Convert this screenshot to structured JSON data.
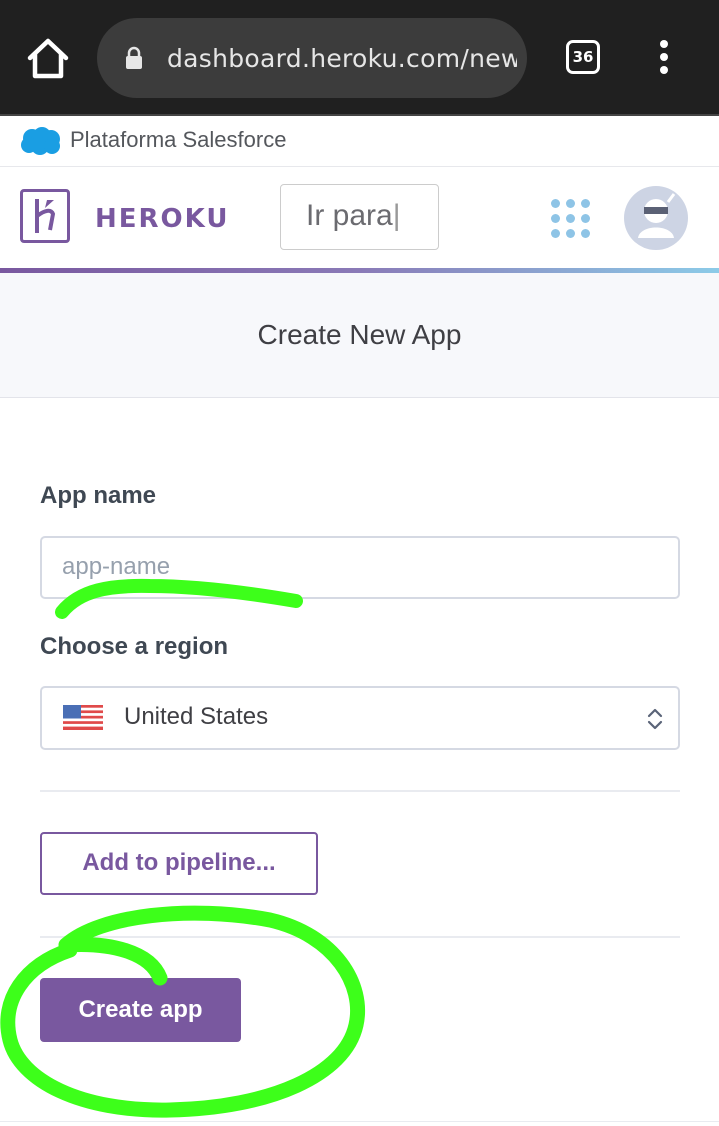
{
  "browser": {
    "url": "dashboard.heroku.com/new-",
    "tab_count": "36"
  },
  "salesforce_bar": {
    "label": "Plataforma Salesforce"
  },
  "heroku_header": {
    "brand": "HEROKU",
    "search_placeholder": "Ir para"
  },
  "page": {
    "title": "Create New App"
  },
  "form": {
    "app_name_label": "App name",
    "app_name_placeholder": "app-name",
    "app_name_value": "",
    "region_label": "Choose a region",
    "region_selected": "United States",
    "add_to_pipeline_label": "Add to pipeline...",
    "create_app_label": "Create app"
  },
  "colors": {
    "heroku_purple": "#79589f",
    "annotation_green": "#3dff1a",
    "chrome_dark": "#202020"
  },
  "icons": [
    "home-icon",
    "lock-icon",
    "tab-switcher-icon",
    "overflow-menu-icon",
    "salesforce-cloud-icon",
    "heroku-logo-icon",
    "apps-grid-icon",
    "user-avatar-icon",
    "us-flag-icon",
    "select-updown-icon"
  ]
}
